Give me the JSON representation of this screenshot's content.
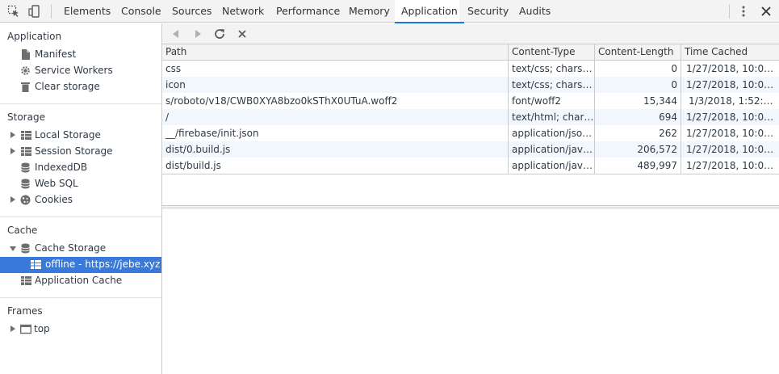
{
  "tabs": [
    "Elements",
    "Console",
    "Sources",
    "Network",
    "Performance",
    "Memory",
    "Application",
    "Security",
    "Audits"
  ],
  "active_tab": "Application",
  "sidebar": {
    "application": {
      "title": "Application",
      "items": [
        "Manifest",
        "Service Workers",
        "Clear storage"
      ]
    },
    "storage": {
      "title": "Storage",
      "items": [
        "Local Storage",
        "Session Storage",
        "IndexedDB",
        "Web SQL",
        "Cookies"
      ]
    },
    "cache": {
      "title": "Cache",
      "items": [
        "Cache Storage",
        "offline - https://jebe.xyz",
        "Application Cache"
      ]
    },
    "frames": {
      "title": "Frames",
      "items": [
        "top"
      ]
    }
  },
  "table": {
    "headers": [
      "Path",
      "Content-Type",
      "Content-Length",
      "Time Cached"
    ],
    "rows": [
      [
        "css",
        "text/css; charse…",
        "0",
        "1/27/2018, 10:0…"
      ],
      [
        "icon",
        "text/css; charse…",
        "0",
        "1/27/2018, 10:0…"
      ],
      [
        "s/roboto/v18/CWB0XYA8bzo0kSThX0UTuA.woff2",
        "font/woff2",
        "15,344",
        "1/3/2018, 1:52:…"
      ],
      [
        "/",
        "text/html; char…",
        "694",
        "1/27/2018, 10:0…"
      ],
      [
        "__/firebase/init.json",
        "application/jso…",
        "262",
        "1/27/2018, 10:0…"
      ],
      [
        "dist/0.build.js",
        "application/jav…",
        "206,572",
        "1/27/2018, 10:0…"
      ],
      [
        "dist/build.js",
        "application/jav…",
        "489,997",
        "1/27/2018, 10:0…"
      ]
    ]
  },
  "colors": {
    "selection": "#3879d9",
    "tab_underline": "#1a73e8",
    "toolbar_bg": "#f3f3f3",
    "alt_row": "#f2f7fd"
  }
}
